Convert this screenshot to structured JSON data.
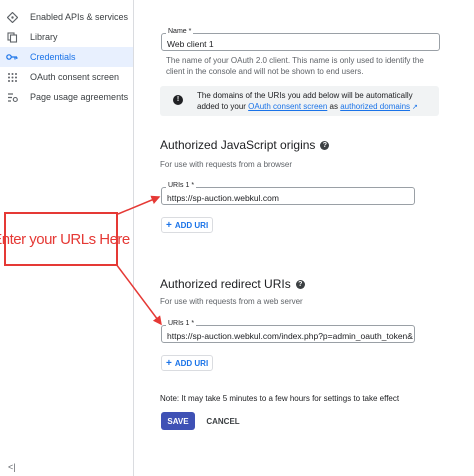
{
  "sidebar": {
    "items": [
      {
        "label": "Enabled APIs & services",
        "icon": "diamond-grid-icon",
        "active": false
      },
      {
        "label": "Library",
        "icon": "library-icon",
        "active": false
      },
      {
        "label": "Credentials",
        "icon": "key-icon",
        "active": true
      },
      {
        "label": "OAuth consent screen",
        "icon": "consent-grid-icon",
        "active": false
      },
      {
        "label": "Page usage agreements",
        "icon": "settings-list-icon",
        "active": false
      }
    ],
    "collapse_label": "<|"
  },
  "name_field": {
    "label": "Name *",
    "value": "Web client 1",
    "helper": "The name of your OAuth 2.0 client. This name is only used to identify the client in the console and will not be shown to end users."
  },
  "info": {
    "text_before": "The domains of the URIs you add below will be automatically added to your ",
    "link1": "OAuth consent screen",
    "text_mid": " as ",
    "link2": "authorized domains"
  },
  "js_origins": {
    "title": "Authorized JavaScript origins",
    "subtitle": "For use with requests from a browser",
    "uri_label": "URIs 1 *",
    "uri_value": "https://sp-auction.webkul.com",
    "add_label": "ADD URI"
  },
  "redirect": {
    "title": "Authorized redirect URIs",
    "subtitle": "For use with requests from a web server",
    "uri_label": "URIs 1 *",
    "uri_value": "https://sp-auction.webkul.com/index.php?p=admin_oauth_token&s",
    "add_label": "ADD URI"
  },
  "note": "Note: It may take 5 minutes to a few hours for settings to take effect",
  "buttons": {
    "save": "SAVE",
    "cancel": "CANCEL"
  },
  "annotation": {
    "text": "Enter your URLs Here",
    "color": "#e53935"
  },
  "colors": {
    "accent": "#1a73e8",
    "save": "#3f51b5",
    "active_bg": "#e8f0fe"
  }
}
